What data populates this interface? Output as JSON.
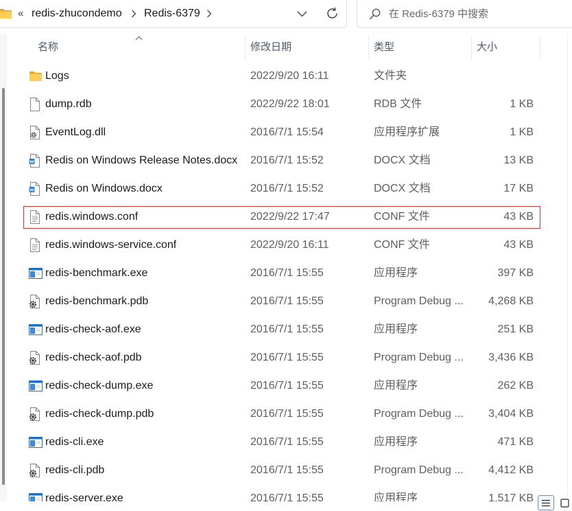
{
  "address_bar": {
    "folder_icon": "folder-icon",
    "overflow": "«",
    "crumbs": [
      "redis-zhucondemo",
      "Redis-6379"
    ],
    "separator_icon": "chevron-right-icon",
    "dropdown_icon": "chevron-down-icon",
    "refresh_icon": "refresh-icon"
  },
  "search": {
    "icon": "search-icon",
    "placeholder": "在 Redis-6379 中搜索"
  },
  "columns": [
    {
      "label": "名称"
    },
    {
      "label": "修改日期"
    },
    {
      "label": "类型"
    },
    {
      "label": "大小"
    }
  ],
  "sort": {
    "column_index": 0,
    "indicator_icon": "sort-ascending-icon"
  },
  "files": [
    {
      "icon": "folder-icon",
      "name": "Logs",
      "modified": "2022/9/20 16:11",
      "type": "文件夹",
      "size": ""
    },
    {
      "icon": "file-icon",
      "name": "dump.rdb",
      "modified": "2022/9/22 18:01",
      "type": "RDB 文件",
      "size": "1 KB"
    },
    {
      "icon": "dll-icon",
      "name": "EventLog.dll",
      "modified": "2016/7/1 15:54",
      "type": "应用程序扩展",
      "size": "1 KB"
    },
    {
      "icon": "word-doc-icon",
      "name": "Redis on Windows Release Notes.docx",
      "modified": "2016/7/1 15:52",
      "type": "DOCX 文档",
      "size": "13 KB"
    },
    {
      "icon": "word-doc-icon",
      "name": "Redis on Windows.docx",
      "modified": "2016/7/1 15:52",
      "type": "DOCX 文档",
      "size": "17 KB"
    },
    {
      "icon": "text-file-icon",
      "name": "redis.windows.conf",
      "modified": "2022/9/22 17:47",
      "type": "CONF 文件",
      "size": "43 KB",
      "annotated": true
    },
    {
      "icon": "text-file-icon",
      "name": "redis.windows-service.conf",
      "modified": "2022/9/20 16:11",
      "type": "CONF 文件",
      "size": "43 KB"
    },
    {
      "icon": "exe-icon",
      "name": "redis-benchmark.exe",
      "modified": "2016/7/1 15:55",
      "type": "应用程序",
      "size": "397 KB"
    },
    {
      "icon": "pdb-icon",
      "name": "redis-benchmark.pdb",
      "modified": "2016/7/1 15:55",
      "type": "Program Debug ...",
      "size": "4,268 KB"
    },
    {
      "icon": "exe-icon",
      "name": "redis-check-aof.exe",
      "modified": "2016/7/1 15:55",
      "type": "应用程序",
      "size": "251 KB"
    },
    {
      "icon": "pdb-icon",
      "name": "redis-check-aof.pdb",
      "modified": "2016/7/1 15:55",
      "type": "Program Debug ...",
      "size": "3,436 KB"
    },
    {
      "icon": "exe-icon",
      "name": "redis-check-dump.exe",
      "modified": "2016/7/1 15:55",
      "type": "应用程序",
      "size": "262 KB"
    },
    {
      "icon": "pdb-icon",
      "name": "redis-check-dump.pdb",
      "modified": "2016/7/1 15:55",
      "type": "Program Debug ...",
      "size": "3,404 KB"
    },
    {
      "icon": "exe-icon",
      "name": "redis-cli.exe",
      "modified": "2016/7/1 15:55",
      "type": "应用程序",
      "size": "471 KB"
    },
    {
      "icon": "pdb-icon",
      "name": "redis-cli.pdb",
      "modified": "2016/7/1 15:55",
      "type": "Program Debug ...",
      "size": "4,412 KB"
    },
    {
      "icon": "exe-icon",
      "name": "redis-server.exe",
      "modified": "2016/7/1 15:55",
      "type": "应用程序",
      "size": "1,517 KB"
    }
  ],
  "view_modes": [
    {
      "icon": "details-view-icon",
      "selected": true
    },
    {
      "icon": "large-icons-view-icon",
      "selected": false
    }
  ],
  "colors": {
    "annotation_border": "#d0373b",
    "selected_view_border": "#6f8db8",
    "folder": "#ffcf55",
    "folder_back": "#e8a92a",
    "exe_accent": "#1f6fc5",
    "word_accent": "#2b7cd3"
  }
}
